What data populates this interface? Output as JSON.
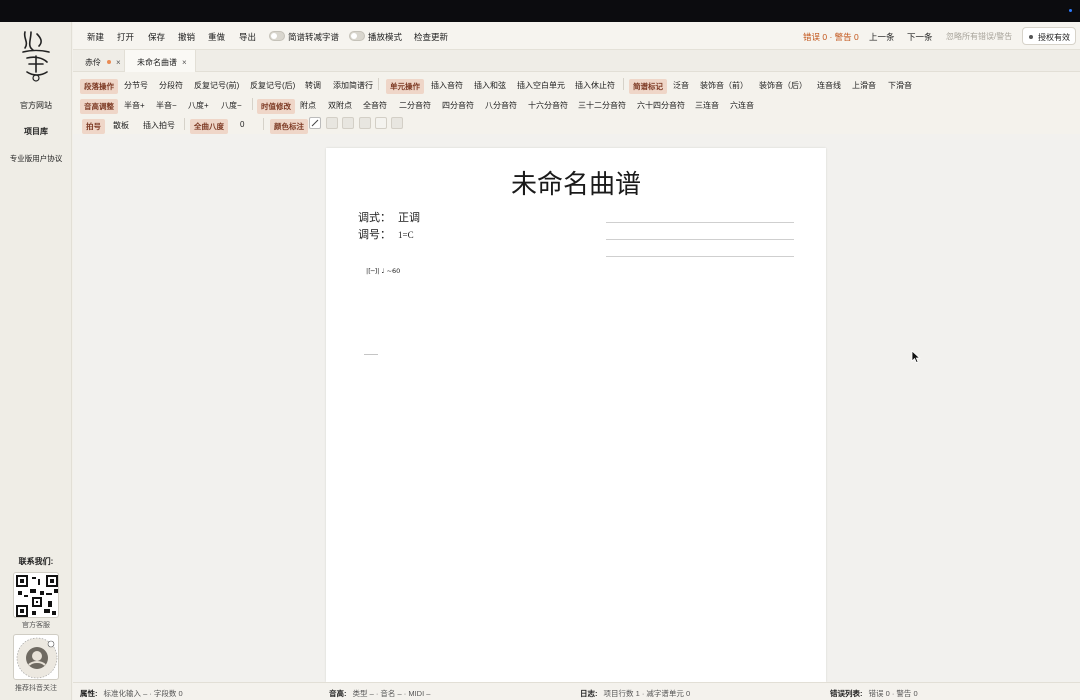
{
  "sidebar": {
    "links": [
      "官方网站",
      "项目库",
      "专业版用户协议"
    ],
    "contact_title": "联系我们:",
    "qr_official_caption": "官方客服",
    "qr_douyin_caption": "推荐抖音关注"
  },
  "toolbar": {
    "new": "新建",
    "open": "打开",
    "save": "保存",
    "undo": "撤销",
    "redo": "重做",
    "export": "导出",
    "toggle_jianpu": "简谱转减字谱",
    "toggle_play": "播放模式",
    "check_update": "检查更新",
    "error_status": "错误 0 · 警告 0",
    "prev": "上一条",
    "next": "下一条",
    "ignore_all": "忽略所有错误/警告",
    "license": "授权有效"
  },
  "tabs": [
    {
      "label": "赤伶",
      "modified": true
    },
    {
      "label": "未命名曲谱",
      "modified": false
    }
  ],
  "ribbon": {
    "row1": {
      "section_tag": "段落操作",
      "items_a": [
        "分节号",
        "分段符",
        "反复记号(前)",
        "反复记号(后)",
        "转调",
        "添加简谱行"
      ],
      "unit_tag": "单元操作",
      "items_b": [
        "插入音符",
        "插入和弦",
        "插入空白单元",
        "插入休止符"
      ],
      "jianpu_tag": "简谱标记",
      "items_c": [
        "泛音",
        "装饰音（前）",
        "装饰音（后）",
        "连音线",
        "上滑音",
        "下滑音"
      ]
    },
    "row2": {
      "pitch_tag": "音高调整",
      "items_a": [
        "半音+",
        "半音−",
        "八度+",
        "八度−"
      ],
      "duration_tag": "时值修改",
      "items_b": [
        "附点",
        "双附点",
        "全音符",
        "二分音符",
        "四分音符",
        "八分音符",
        "十六分音符",
        "三十二分音符",
        "六十四分音符",
        "三连音",
        "六连音"
      ]
    },
    "row3": {
      "beat_tag": "拍号",
      "items_a": [
        "散板",
        "插入拍号"
      ],
      "octave_tag": "全曲八度",
      "octave_value": "0",
      "color_tag": "颜色标注"
    }
  },
  "score": {
    "title": "未命名曲谱",
    "mode_label": "调式：",
    "mode_value": "正调",
    "key_label": "调号：",
    "key_value": "1=C",
    "tempo_mark": "|[─]| ♩ ~60"
  },
  "statusbar": {
    "attr_label": "属性:",
    "attr_value": "标准化输入 – · 字段数 0",
    "pitch_label": "音高:",
    "pitch_value": "类型 – · 音名 – · MIDI –",
    "log_label": "日志:",
    "log_value": "项目行数 1 · 减字谱单元 0",
    "err_label": "错误列表:",
    "err_value": "错误 0 · 警告 0"
  }
}
